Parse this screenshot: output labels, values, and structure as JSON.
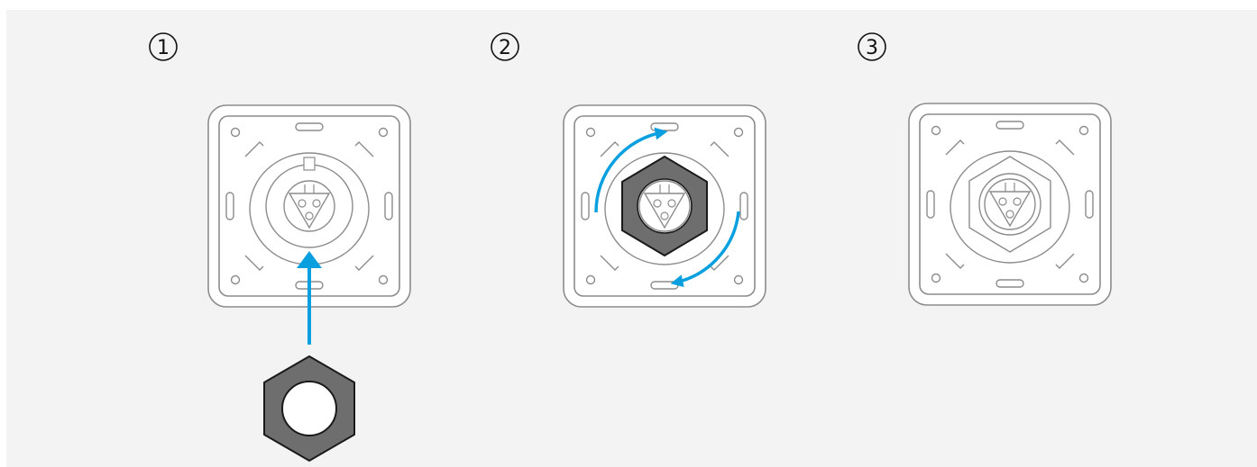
{
  "steps": [
    {
      "number": "1",
      "action": "insert-nut"
    },
    {
      "number": "2",
      "action": "rotate-nut"
    },
    {
      "number": "3",
      "action": "installed"
    }
  ],
  "colors": {
    "background": "#f3f3f3",
    "outline": "#8c8c8c",
    "arrow": "#0aa0e0",
    "nut_fill": "#6e6e6e",
    "nut_stroke": "#1a1a1a",
    "plate_fill": "#ffffff"
  },
  "icons": [
    "circled-number",
    "socket-plate",
    "hex-nut",
    "insert-arrow",
    "rotate-arrow"
  ]
}
